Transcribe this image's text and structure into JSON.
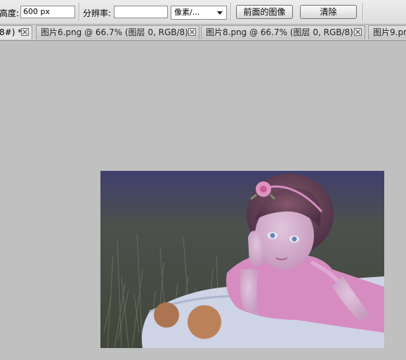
{
  "options_bar": {
    "height_label": "高度:",
    "height_value": "600 px",
    "resolution_label": "分辨率:",
    "resolution_value": "",
    "unit_select": "像素/...",
    "front_image_button": "前面的图像",
    "clear_button": "清除"
  },
  "tabs": [
    {
      "label": "8#) *",
      "active": true
    },
    {
      "label": "图片6.png @ 66.7% (图层 0, RGB/8) *",
      "active": false
    },
    {
      "label": "图片8.png @ 66.7% (图层 0, RGB/8) *",
      "active": false
    },
    {
      "label": "图片9.pn",
      "active": false
    }
  ],
  "colors": {
    "canvas_background": "#c0c0c0",
    "photo_grass": "#46523a",
    "photo_tint": "#5a4a8a",
    "dress_pink": "#e896c8"
  },
  "icons": {
    "tab_close": "close-icon",
    "dropdown": "chevron-down-icon"
  }
}
